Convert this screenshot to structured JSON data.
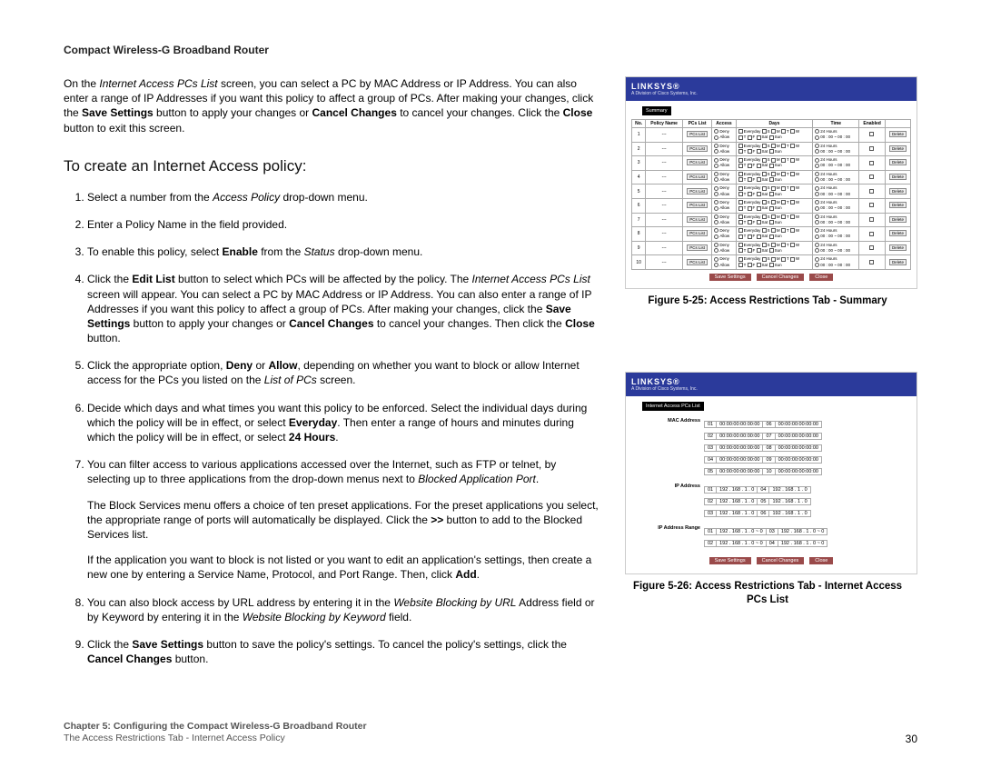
{
  "header_title": "Compact Wireless-G Broadband Router",
  "intro": {
    "p1a": "On the ",
    "p1b_ital": "Internet Access PCs List",
    "p1c": " screen, you can select a PC by MAC Address or IP Address. You can also enter a range of IP Addresses if you want this policy to affect a group of PCs. After making your changes, click the ",
    "p1d_bold": "Save Settings",
    "p1e": " button to apply your changes or ",
    "p1f_bold": "Cancel Changes",
    "p1g": " to cancel your changes. Click the ",
    "p1h_bold": "Close",
    "p1i": " button to exit this screen."
  },
  "section_heading": "To create an Internet Access policy:",
  "steps": {
    "s1a": "Select a number from the ",
    "s1b_ital": "Access Policy",
    "s1c": " drop-down menu.",
    "s2": "Enter a Policy Name in the field provided.",
    "s3a": "To enable this policy, select ",
    "s3b_bold": "Enable",
    "s3c": " from the ",
    "s3d_ital": "Status",
    "s3e": " drop-down menu.",
    "s4a": "Click the ",
    "s4b_bold": "Edit List",
    "s4c": " button to select which PCs will be affected by the policy. The ",
    "s4d_ital": "Internet Access PCs List",
    "s4e": " screen will appear. You can select a PC by MAC Address or IP Address. You can also enter a range of IP Addresses if you want this policy to affect a group of PCs. After making your changes, click the ",
    "s4f_bold": "Save Settings",
    "s4g": " button to apply your changes or ",
    "s4h_bold": "Cancel Changes",
    "s4i": " to cancel your changes. Then click the ",
    "s4j_bold": "Close",
    "s4k": " button.",
    "s5a": "Click the appropriate option, ",
    "s5b_bold": "Deny",
    "s5c": " or ",
    "s5d_bold": "Allow",
    "s5e": ", depending on whether you want to block or allow Internet access for the PCs you listed on the ",
    "s5f_ital": "List of PCs",
    "s5g": " screen.",
    "s6a": "Decide which days and what times you want this policy to be enforced. Select the individual days during which the policy will be in effect, or select ",
    "s6b_bold": "Everyday",
    "s6c": ". Then enter a range of hours and minutes during which the policy will be in effect, or select ",
    "s6d_bold": "24 Hours",
    "s6e": ".",
    "s7a": "You can filter access to various applications accessed over the Internet, such as FTP or telnet, by selecting up to three applications from the drop-down menus next to ",
    "s7b_ital": "Blocked Application Port",
    "s7c": ".",
    "s7_p2a": "The Block Services menu offers a choice of ten preset applications. For the preset applications you select, the appropriate range of ports will automatically be displayed. Click the ",
    "s7_p2b_bold": ">>",
    "s7_p2c": " button to add to the Blocked Services list.",
    "s7_p3a": "If the application you want to block is not listed or you want to edit an application's settings, then create a new one by entering a Service Name, Protocol, and Port Range. Then, click ",
    "s7_p3b_bold": "Add",
    "s7_p3c": ".",
    "s8a": "You can also block access by URL address by entering it in the ",
    "s8b_ital": "Website Blocking by URL",
    "s8c": " Address field or by Keyword by entering it in the ",
    "s8d_ital": "Website Blocking by Keyword",
    "s8e": " field.",
    "s9a": "Click the ",
    "s9b_bold": "Save Settings",
    "s9c": " button to save the policy's settings. To cancel the policy's settings, click the ",
    "s9d_bold": "Cancel Changes",
    "s9e": " button."
  },
  "fig25_caption": "Figure 5-25: Access Restrictions Tab - Summary",
  "fig26_caption_l1": "Figure 5-26: Access Restrictions Tab - Internet Access",
  "fig26_caption_l2": "PCs List",
  "footer": {
    "line1": "Chapter 5: Configuring the Compact Wireless-G Broadband Router",
    "line2": "The Access Restrictions Tab - Internet Access Policy",
    "page": "30"
  },
  "shot1": {
    "brand": "LINKSYS®",
    "brand_sub": "A Division of Cisco Systems, Inc.",
    "tab": "Summary",
    "headers": [
      "No.",
      "Policy Name",
      "PCs List",
      "Access",
      "Days",
      "Time",
      "Enabled",
      ""
    ],
    "rows": [
      1,
      2,
      3,
      4,
      5,
      6,
      7,
      8,
      9,
      10
    ],
    "pcs_list_btn": "PCs List",
    "deny": "Deny",
    "allow": "Allow",
    "everyday": "Everyday",
    "days_abbrev": "S M T W T F Sat Sun",
    "h24": "24 Hours",
    "time_fields": "00 : 00  ~  00 : 00",
    "delete": "Delete",
    "save": "Save Settings",
    "cancel": "Cancel Changes",
    "close": "Close"
  },
  "shot2": {
    "brand": "LINKSYS®",
    "brand_sub": "A Division of Cisco Systems, Inc.",
    "tab": "Internet Access PCs List",
    "mac_label": "MAC Address",
    "mac_rows": [
      [
        "01",
        "00:00:00:00:00:00",
        "06",
        "00:00:00:00:00:00"
      ],
      [
        "02",
        "00:00:00:00:00:00",
        "07",
        "00:00:00:00:00:00"
      ],
      [
        "03",
        "00:00:00:00:00:00",
        "08",
        "00:00:00:00:00:00"
      ],
      [
        "04",
        "00:00:00:00:00:00",
        "09",
        "00:00:00:00:00:00"
      ],
      [
        "05",
        "00:00:00:00:00:00",
        "10",
        "00:00:00:00:00:00"
      ]
    ],
    "ip_label": "IP Address",
    "ip_rows": [
      [
        "01",
        "192 . 168 . 1 . 0",
        "04",
        "192 . 168 . 1 . 0"
      ],
      [
        "02",
        "192 . 168 . 1 . 0",
        "05",
        "192 . 168 . 1 . 0"
      ],
      [
        "03",
        "192 . 168 . 1 . 0",
        "06",
        "192 . 168 . 1 . 0"
      ]
    ],
    "range_label": "IP Address Range",
    "range_rows": [
      [
        "01",
        "192 . 168 . 1 . 0 ~ 0",
        "03",
        "192 . 168 . 1 . 0 ~ 0"
      ],
      [
        "02",
        "192 . 168 . 1 . 0 ~ 0",
        "04",
        "192 . 168 . 1 . 0 ~ 0"
      ]
    ],
    "save": "Save Settings",
    "cancel": "Cancel Changes",
    "close": "Close"
  }
}
